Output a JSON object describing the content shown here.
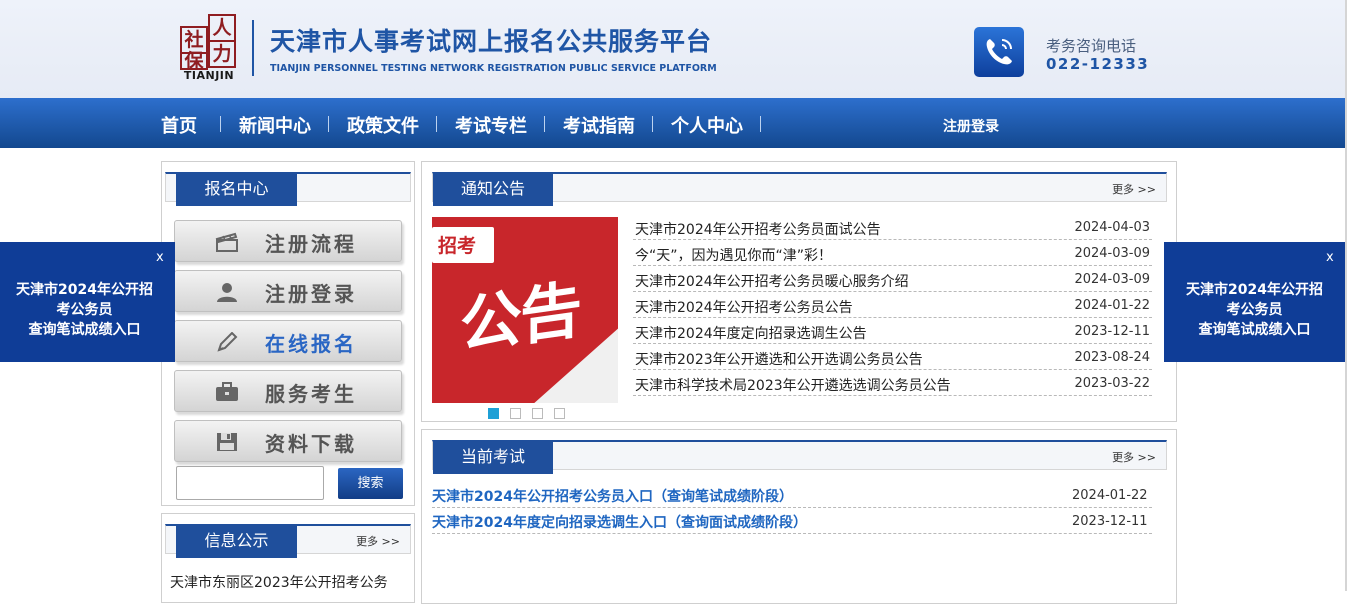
{
  "header": {
    "logo_chars": [
      "人",
      "社",
      "力",
      "保"
    ],
    "logo_en": "TIANJIN",
    "title": "天津市人事考试网上报名公共服务平台",
    "subtitle": "TIANJIN PERSONNEL TESTING NETWORK REGISTRATION PUBLIC SERVICE PLATFORM",
    "phone_label": "考务咨询电话",
    "phone_number": "022-12333",
    "phone_icon": "phone-icon"
  },
  "nav": {
    "items": [
      {
        "label": "首页"
      },
      {
        "label": "新闻中心"
      },
      {
        "label": "政策文件"
      },
      {
        "label": "考试专栏"
      },
      {
        "label": "考试指南"
      },
      {
        "label": "个人中心"
      }
    ],
    "login_label": "注册登录"
  },
  "registration_center": {
    "title": "报名中心",
    "buttons": [
      {
        "label": "注册流程",
        "icon": "clapper-icon"
      },
      {
        "label": "注册登录",
        "icon": "user-icon"
      },
      {
        "label": "在线报名",
        "icon": "pen-icon",
        "active": true
      },
      {
        "label": "服务考生",
        "icon": "briefcase-icon"
      },
      {
        "label": "资料下载",
        "icon": "floppy-icon"
      }
    ],
    "search_button": "搜索",
    "search_value": ""
  },
  "info_public": {
    "title": "信息公示",
    "more": "更多 >>",
    "first_item": "天津市东丽区2023年公开招考公务"
  },
  "notice": {
    "title": "通知公告",
    "more": "更多 >>",
    "banner_small": "招考",
    "banner_big": "公告",
    "items": [
      {
        "title": "天津市2024年公开招考公务员面试公告",
        "date": "2024-04-03"
      },
      {
        "title": "今“天”，因为遇见你而“津”彩！",
        "date": "2024-03-09"
      },
      {
        "title": "天津市2024年公开招考公务员暖心服务介绍",
        "date": "2024-03-09"
      },
      {
        "title": "天津市2024年公开招考公务员公告",
        "date": "2024-01-22"
      },
      {
        "title": "天津市2024年度定向招录选调生公告",
        "date": "2023-12-11"
      },
      {
        "title": "天津市2023年公开遴选和公开选调公务员公告",
        "date": "2023-08-24"
      },
      {
        "title": "天津市科学技术局2023年公开遴选选调公务员公告",
        "date": "2023-03-22"
      }
    ],
    "slides": 4,
    "active_slide": 0
  },
  "current_exam": {
    "title": "当前考试",
    "more": "更多 >>",
    "items": [
      {
        "title": "天津市2024年公开招考公务员入口（查询笔试成绩阶段）",
        "date": "2024-01-22"
      },
      {
        "title": "天津市2024年度定向招录选调生入口（查询面试成绩阶段）",
        "date": "2023-12-11"
      }
    ]
  },
  "float_ads": {
    "close": "x",
    "line1": "天津市2024年公开招",
    "line2": "考公务员",
    "line3": "查询笔试成绩入口"
  },
  "colors": {
    "brand_blue": "#1f4f9c",
    "nav_blue": "#2d6fcd",
    "link_blue": "#1f66c1",
    "logo_red": "#8f1d21",
    "banner_red": "#c8262b"
  }
}
